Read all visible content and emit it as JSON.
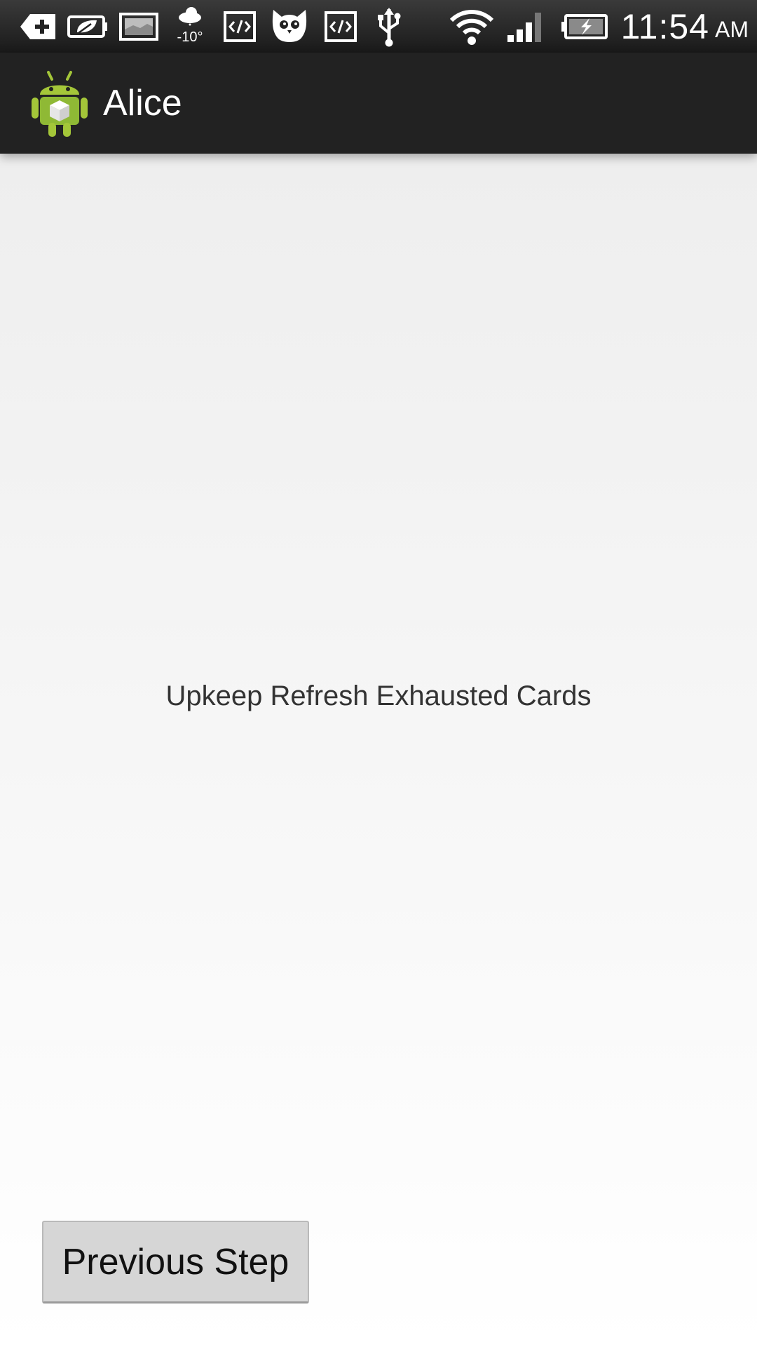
{
  "status_bar": {
    "icons": [
      "add-notification-icon",
      "eco-battery-icon",
      "gallery-icon",
      "weather-icon",
      "developer-code-icon",
      "owl-app-icon",
      "developer-code-icon-2",
      "usb-icon",
      "wifi-icon",
      "cell-signal-icon",
      "battery-charging-icon"
    ],
    "weather_temp": "-10°",
    "time": "11:54",
    "ampm": "AM"
  },
  "action_bar": {
    "app_icon": "android-robot-icon",
    "title": "Alice"
  },
  "main": {
    "message": "Upkeep Refresh Exhausted Cards",
    "previous_button_label": "Previous Step"
  },
  "colors": {
    "status_bar_bg": "#222222",
    "action_bar_bg": "#222222",
    "android_green": "#9bc53d",
    "button_bg": "#d6d6d6",
    "text_dark": "#333333"
  }
}
